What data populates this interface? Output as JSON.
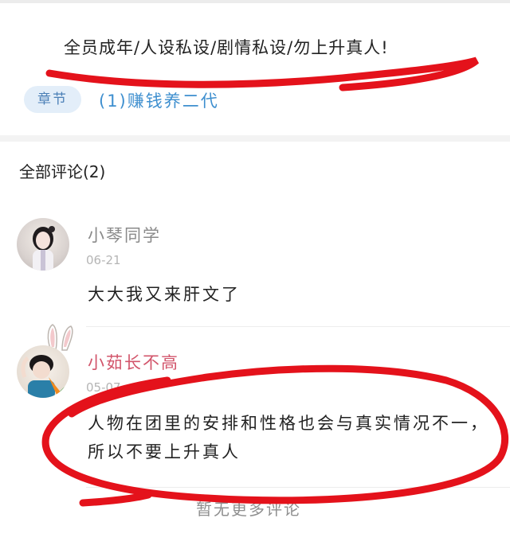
{
  "work": {
    "notice": "全员成年/人设私设/剧情私设/勿上升真人!",
    "chapter_tag": "章节",
    "chapter_title": "(1)赚钱养二代"
  },
  "comments_section": {
    "title": "全部评论(2)",
    "comments": [
      {
        "username": "小琴同学",
        "date": "06-21",
        "text": "大大我又来肝文了"
      },
      {
        "username": "小茹长不高",
        "date": "05-07",
        "text": "人物在团里的安排和性格也会与真实情况不一，所以不要上升真人"
      }
    ],
    "more_label": "暂无更多评论"
  },
  "colors": {
    "markup_red": "#e4121b",
    "chapter_link": "#3e8fcf",
    "username_pink": "#d2556b"
  }
}
